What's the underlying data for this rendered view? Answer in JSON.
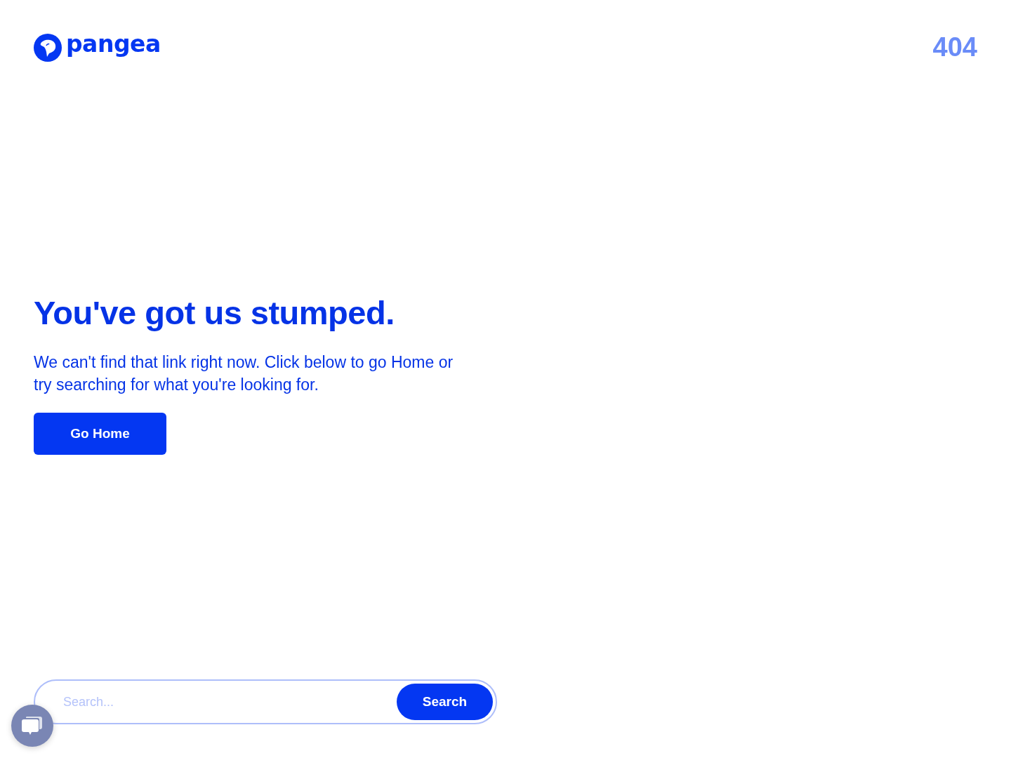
{
  "header": {
    "logo_text": "pangea",
    "error_code": "404"
  },
  "message": {
    "heading": "You've got us stumped.",
    "body": "We can't find that link right now. Click below to go Home or try searching for what you're looking for.",
    "button": "Go Home"
  },
  "search": {
    "placeholder": "Search...",
    "button": "Search"
  }
}
